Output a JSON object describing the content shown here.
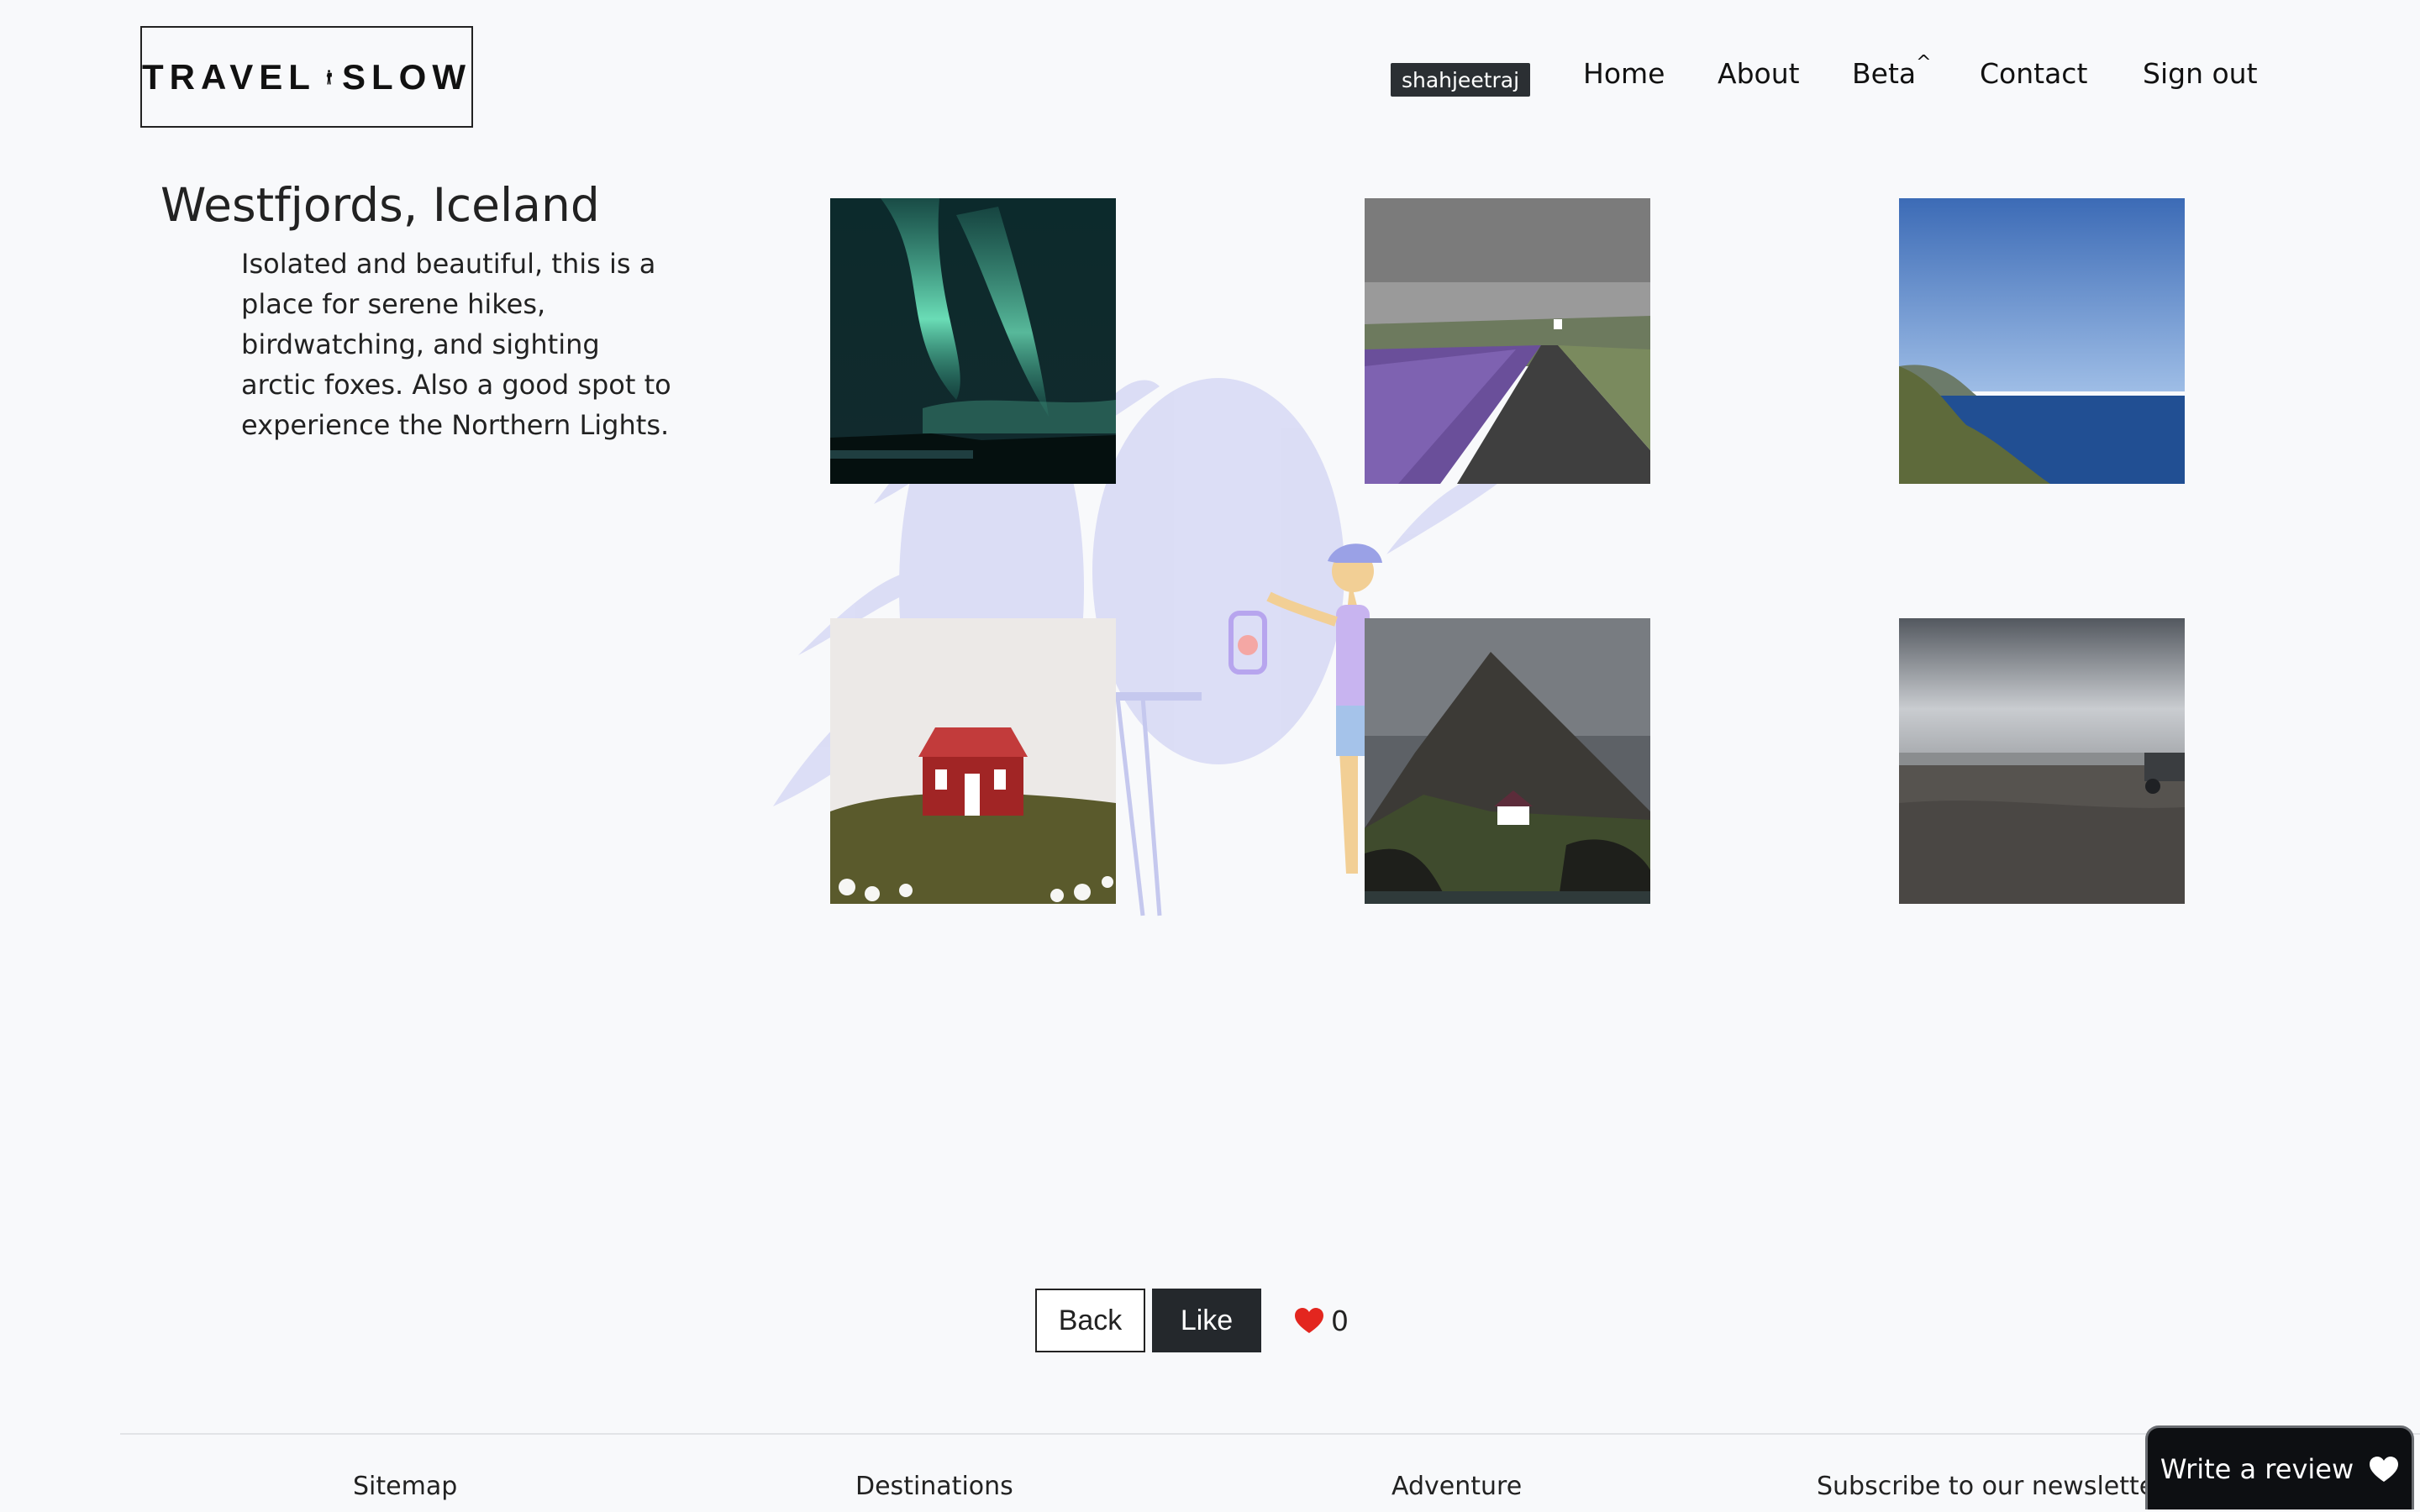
{
  "brand": {
    "logo_left": "TRAVEL",
    "logo_right": "SLOW"
  },
  "nav": {
    "user": "shahjeetraj",
    "links": [
      "Home",
      "About",
      "Beta",
      "Contact",
      "Sign out"
    ],
    "beta_marker": "^"
  },
  "destination": {
    "title": "Westfjords, Iceland",
    "description": "Isolated and beautiful, this is a place for serene hikes, birdwatching, and sighting arctic foxes. Also a good spot to experience the Northern Lights."
  },
  "gallery": {
    "photos": [
      {
        "subject": "northern-lights"
      },
      {
        "subject": "lupine-road-church"
      },
      {
        "subject": "fjord-coast"
      },
      {
        "subject": "red-cabin"
      },
      {
        "subject": "mountain-white-house"
      },
      {
        "subject": "gravel-plain-jeep"
      }
    ]
  },
  "actions": {
    "back": "Back",
    "like": "Like",
    "likes": "0"
  },
  "footer": {
    "columns": [
      "Sitemap",
      "Destinations",
      "Adventure",
      "Subscribe to our newsletter"
    ],
    "review_button": "Write a review"
  },
  "colors": {
    "accent_dark": "#24282c",
    "heart": "#e3261f",
    "illustration": "#c5c8ee"
  }
}
